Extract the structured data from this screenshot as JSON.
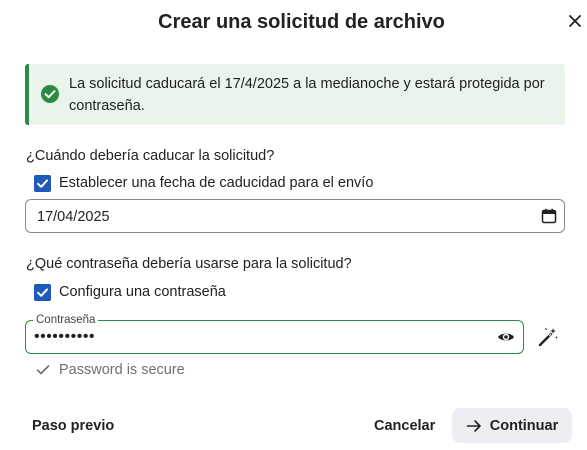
{
  "dialog": {
    "title": "Crear una solicitud de archivo",
    "close_icon": "close-icon"
  },
  "notice": {
    "icon": "check-circle-icon",
    "text": "La solicitud caducará el 17/4/2025 a la medianoche y estará protegida por contraseña.",
    "accent_color": "#2e8b45",
    "background_color": "#e9f4ea"
  },
  "expiration": {
    "question": "¿Cuándo debería caducar la solicitud?",
    "checkbox_label": "Establecer una fecha de caducidad para el envío",
    "checkbox_checked": true,
    "date_value": "17/04/2025",
    "calendar_icon": "calendar-icon"
  },
  "password": {
    "question": "¿Qué contraseña debería usarse para la solicitud?",
    "checkbox_label": "Configura una contraseña",
    "checkbox_checked": true,
    "field_label": "Contraseña",
    "field_value": "••••••••••",
    "show_icon": "eye-icon",
    "generate_icon": "magic-wand-icon",
    "status_icon": "check-icon",
    "status_text": "Password is secure"
  },
  "footer": {
    "previous_label": "Paso previo",
    "cancel_label": "Cancelar",
    "continue_label": "Continuar",
    "continue_icon": "arrow-right-icon"
  },
  "colors": {
    "checkbox": "#1e5bb8",
    "valid_border": "#2e8b45",
    "primary_button_bg": "#eceef3"
  }
}
